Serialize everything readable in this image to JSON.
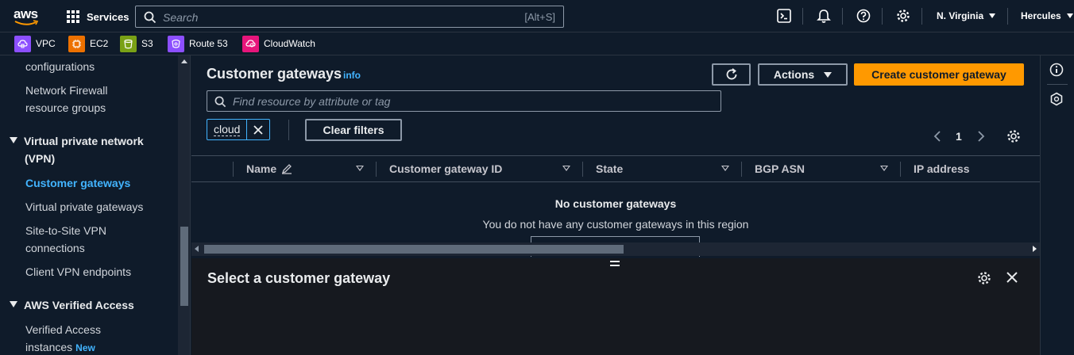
{
  "topnav": {
    "logo_text": "aws",
    "services_label": "Services",
    "search_placeholder": "Search",
    "search_shortcut": "[Alt+S]",
    "region": "N. Virginia",
    "user": "Hercules"
  },
  "favorites": [
    {
      "label": "VPC",
      "icon": "vpc-icon",
      "color": "#8c4fff"
    },
    {
      "label": "EC2",
      "icon": "ec2-icon",
      "color": "#ed7100"
    },
    {
      "label": "S3",
      "icon": "s3-icon",
      "color": "#7aa116"
    },
    {
      "label": "Route 53",
      "icon": "route53-icon",
      "color": "#8c4fff"
    },
    {
      "label": "CloudWatch",
      "icon": "cloudwatch-icon",
      "color": "#e7157b"
    }
  ],
  "sidebar": {
    "items": [
      {
        "label": "configurations"
      },
      {
        "label": "Network Firewall"
      },
      {
        "label": "resource groups"
      },
      {
        "label": "Virtual private network"
      },
      {
        "label": "(VPN)"
      },
      {
        "label": "Customer gateways"
      },
      {
        "label": "Virtual private gateways"
      },
      {
        "label": "Site-to-Site VPN"
      },
      {
        "label": "connections"
      },
      {
        "label": "Client VPN endpoints"
      },
      {
        "label": "AWS Verified Access"
      },
      {
        "label": "Verified Access"
      },
      {
        "label": "instances"
      }
    ],
    "new_badge": "New"
  },
  "main": {
    "title": "Customer gateways",
    "info_label": "info",
    "actions_label": "Actions",
    "create_label": "Create customer gateway",
    "filter_placeholder": "Find resource by attribute or tag",
    "filter_token": "cloud",
    "clear_filters_label": "Clear filters",
    "page_number": "1",
    "columns": [
      "Name",
      "Customer gateway ID",
      "State",
      "BGP ASN",
      "IP address"
    ],
    "empty_title": "No customer gateways",
    "empty_desc": "You do not have any customer gateways in this region",
    "detail_title": "Select a customer gateway"
  },
  "colors": {
    "accent": "#ff9900",
    "link": "#42b4ff",
    "background": "#0f1b2a"
  }
}
